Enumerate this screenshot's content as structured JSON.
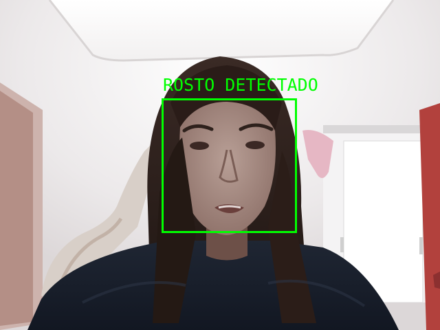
{
  "overlay": {
    "label": "ROSTO DETECTADO",
    "color": "#00ff00"
  },
  "scene": {
    "subject": "webcam-frame-person"
  }
}
